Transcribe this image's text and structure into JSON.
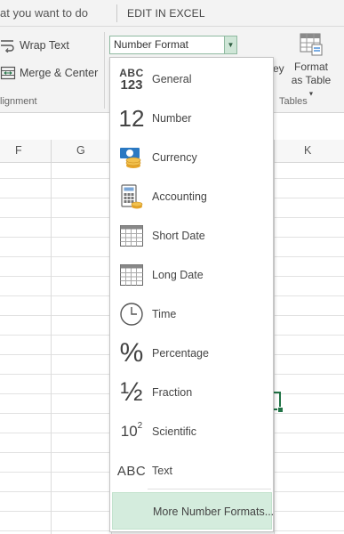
{
  "topbar": {
    "tell_me": "at you want to do",
    "edit_in_excel": "EDIT IN EXCEL"
  },
  "ribbon": {
    "wrap_text": "Wrap Text",
    "merge_center": "Merge & Center",
    "alignment_group": "lignment",
    "number_format_value": "Number Format",
    "styles_fragment": "ey",
    "format_as_table_line1": "Format",
    "format_as_table_line2": "as Table",
    "tables_group": "Tables"
  },
  "sheet": {
    "columns": [
      "F",
      "G",
      "K"
    ]
  },
  "menu": {
    "items": [
      {
        "label": "General",
        "icon": "abc-123-icon"
      },
      {
        "label": "Number",
        "icon": "number-12-icon"
      },
      {
        "label": "Currency",
        "icon": "currency-icon"
      },
      {
        "label": "Accounting",
        "icon": "accounting-icon"
      },
      {
        "label": "Short Date",
        "icon": "short-date-calendar-icon"
      },
      {
        "label": "Long Date",
        "icon": "long-date-calendar-icon"
      },
      {
        "label": "Time",
        "icon": "clock-icon"
      },
      {
        "label": "Percentage",
        "icon": "percent-icon"
      },
      {
        "label": "Fraction",
        "icon": "fraction-icon"
      },
      {
        "label": "Scientific",
        "icon": "scientific-icon"
      },
      {
        "label": "Text",
        "icon": "abc-text-icon"
      }
    ],
    "more": "More Number Formats..."
  },
  "icon_glyphs": {
    "general_top": "ABC",
    "general_bottom": "123",
    "number": "12",
    "percent": "%",
    "fraction": "½",
    "scientific_base": "10",
    "scientific_exp": "2",
    "text": "ABC"
  },
  "colors": {
    "accent_green": "#217346",
    "hover_green": "#d4ecdd",
    "ribbon_bg": "#f3f3f3"
  }
}
